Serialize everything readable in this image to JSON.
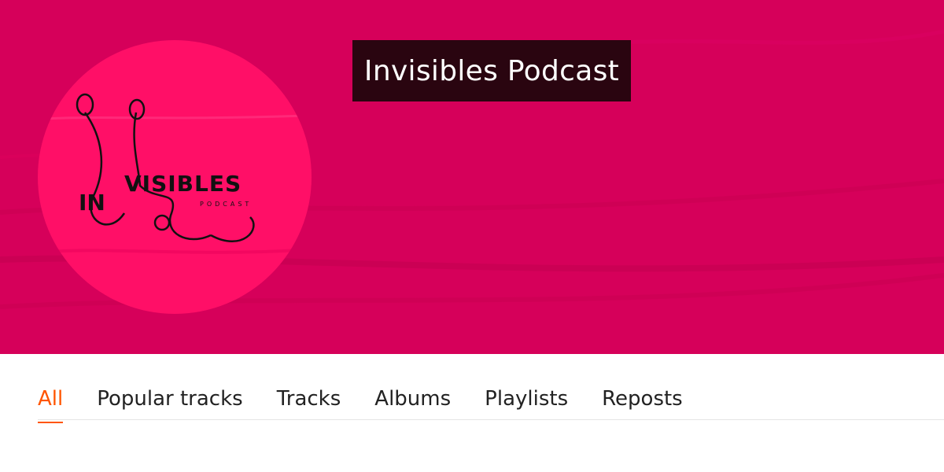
{
  "profile": {
    "name": "Invisibles Podcast",
    "avatar_logo_text": "INVISIBLES PODCAST",
    "banner_color": "#d6005a",
    "avatar_color": "#ff0f67"
  },
  "tabs": {
    "items": [
      {
        "label": "All",
        "active": true
      },
      {
        "label": "Popular tracks",
        "active": false
      },
      {
        "label": "Tracks",
        "active": false
      },
      {
        "label": "Albums",
        "active": false
      },
      {
        "label": "Playlists",
        "active": false
      },
      {
        "label": "Reposts",
        "active": false
      }
    ],
    "active_color": "#ff5500"
  }
}
